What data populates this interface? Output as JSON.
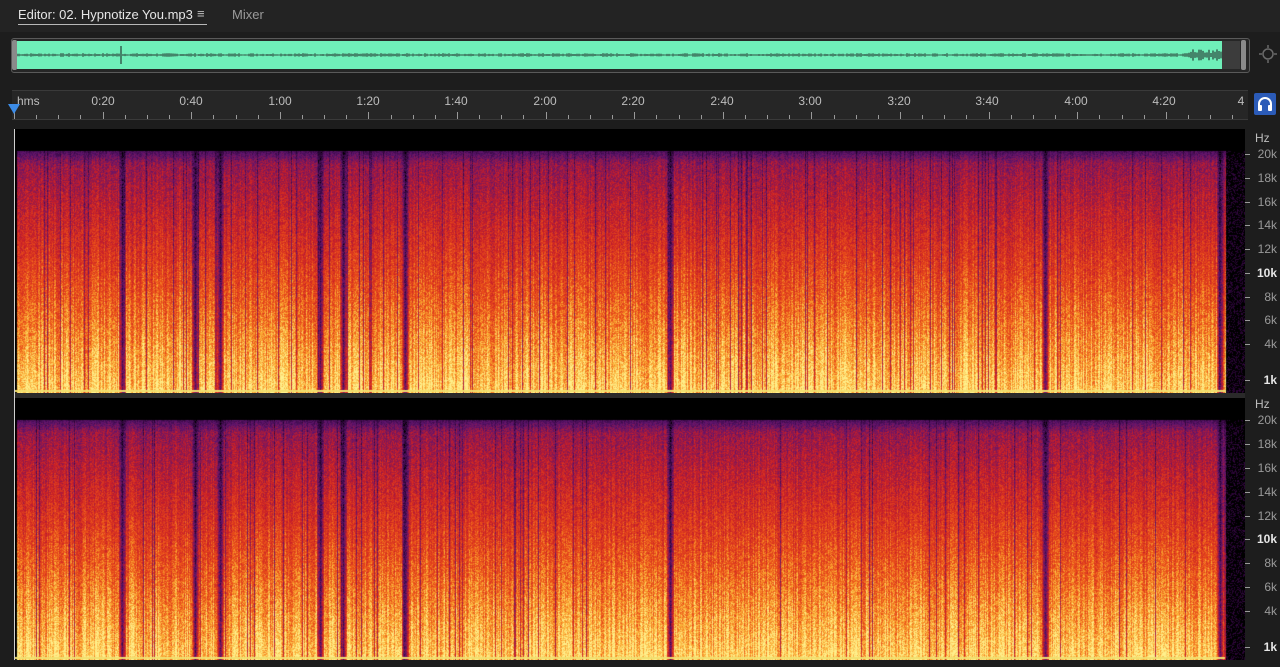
{
  "tabs": {
    "editor_label": "Editor: 02. Hypnotize You.mp3",
    "menu_glyph": "≡",
    "mixer_label": "Mixer"
  },
  "ruler": {
    "unit": "hms",
    "labels": [
      "0:20",
      "0:40",
      "1:00",
      "1:20",
      "1:40",
      "2:00",
      "2:20",
      "2:40",
      "3:00",
      "3:20",
      "3:40",
      "4:00",
      "4:20",
      "4"
    ]
  },
  "hz_scale": {
    "unit": "Hz",
    "labels": [
      {
        "text": "20k",
        "bold": false
      },
      {
        "text": "18k",
        "bold": false
      },
      {
        "text": "16k",
        "bold": false
      },
      {
        "text": "14k",
        "bold": false
      },
      {
        "text": "12k",
        "bold": false
      },
      {
        "text": "10k",
        "bold": true
      },
      {
        "text": "8k",
        "bold": false
      },
      {
        "text": "6k",
        "bold": false
      },
      {
        "text": "4k",
        "bold": false
      },
      {
        "text": "1k",
        "bold": true
      }
    ]
  },
  "icons": {
    "zoom": "zoom-navigator-icon",
    "snap": "headphones-monitor-icon",
    "playhead": "playhead-marker-icon"
  },
  "colors": {
    "overview_wave": "#6fefb9",
    "accent_blue": "#3c8ce7",
    "spectrogram_low": "#ffd86a",
    "spectrogram_mid": "#e8341c",
    "spectrogram_high": "#5a1a6e"
  }
}
